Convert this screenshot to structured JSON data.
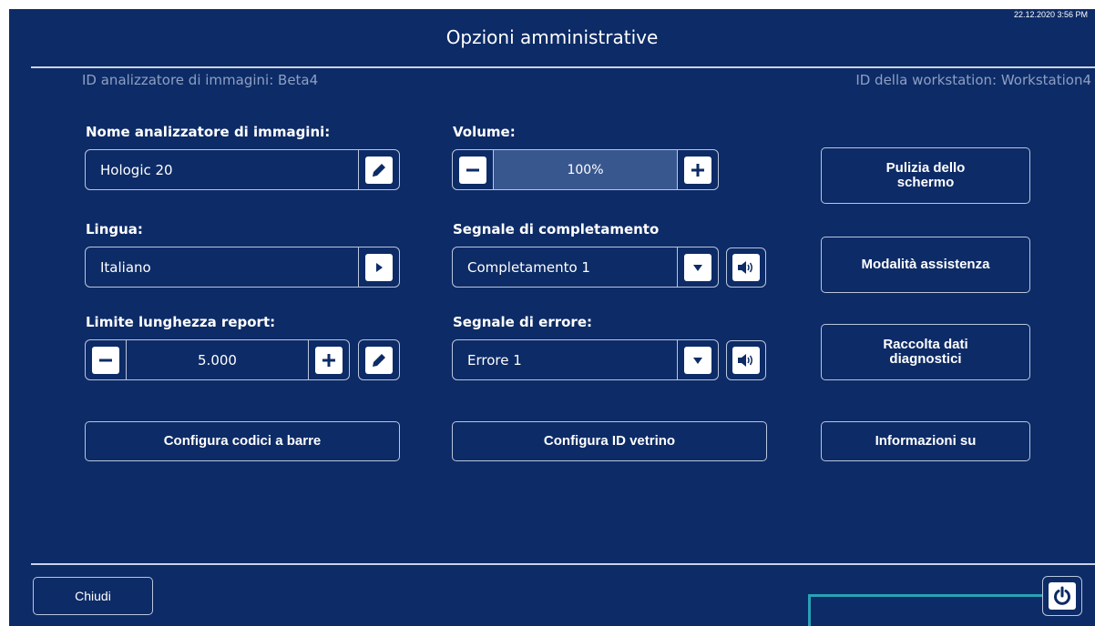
{
  "header": {
    "timestamp": "22.12.2020 3:56 PM",
    "title": "Opzioni amministrative",
    "analyzer_id": "ID analizzatore di immagini: Beta4",
    "workstation_id": "ID della workstation: Workstation4"
  },
  "analyzer_name": {
    "label": "Nome analizzatore di immagini:",
    "value": "Hologic 20",
    "edit_icon": "pencil-icon"
  },
  "language": {
    "label": "Lingua:",
    "value": "Italiano",
    "arrow_icon": "arrow-right-icon"
  },
  "report_limit": {
    "label": "Limite lunghezza report:",
    "value": "5.000",
    "minus_icon": "minus-icon",
    "plus_icon": "plus-icon",
    "edit_icon": "pencil-icon"
  },
  "volume": {
    "label": "Volume:",
    "value": "100%",
    "level": 100,
    "minus_icon": "minus-icon",
    "plus_icon": "plus-icon"
  },
  "completion_signal": {
    "label": "Segnale di completamento",
    "value": "Completamento 1",
    "dropdown_icon": "chevron-down-icon",
    "speaker_icon": "speaker-icon"
  },
  "error_signal": {
    "label": "Segnale di errore:",
    "value": "Errore 1",
    "dropdown_icon": "chevron-down-icon",
    "speaker_icon": "speaker-icon"
  },
  "buttons": {
    "screen_cleaning": "Pulizia dello schermo",
    "service_mode": "Modalità assistenza",
    "diagnostic_data": "Raccolta dati diagnostici",
    "barcodes": "Configura codici a barre",
    "slide_id": "Configura ID vetrino",
    "about": "Informazioni su",
    "close": "Chiudi"
  },
  "footer": {
    "power_icon": "power-icon"
  },
  "colors": {
    "background": "#0d2b66",
    "border": "#b9c6de",
    "muted_text": "#8da0c4",
    "volume_fill": "#39578f",
    "callout_line": "#2aa1b7"
  }
}
